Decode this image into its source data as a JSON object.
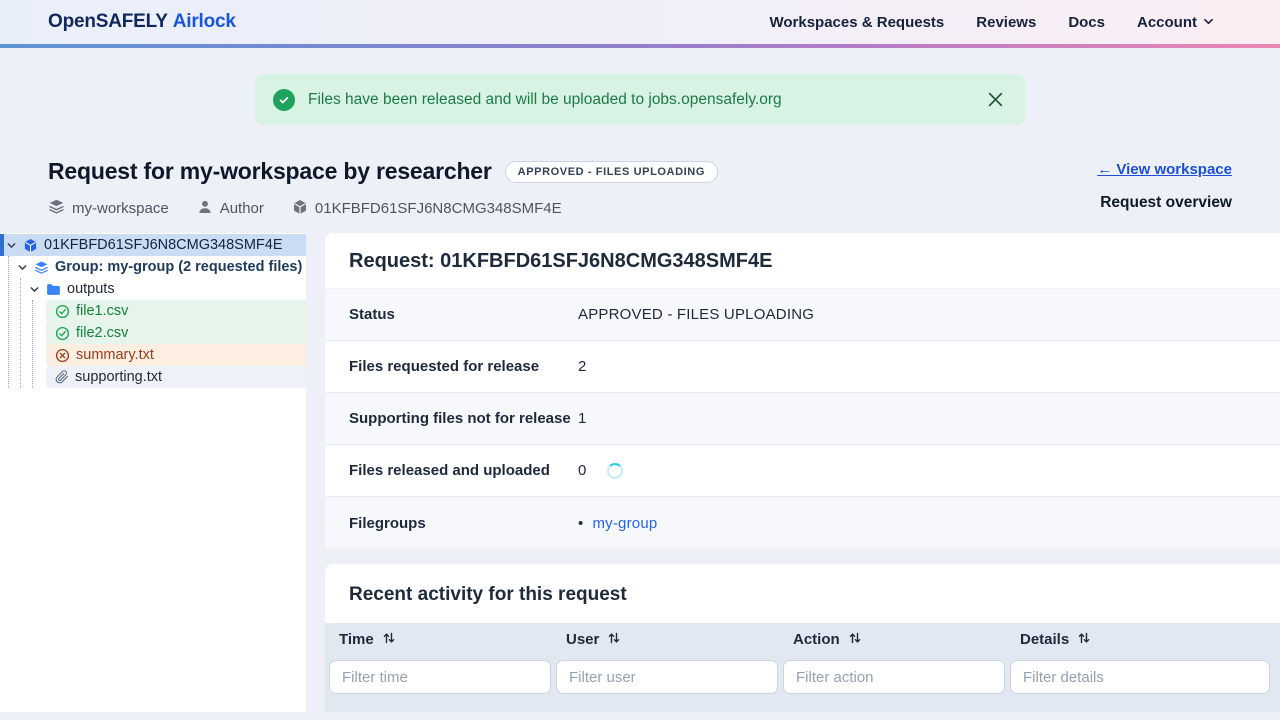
{
  "navbar": {
    "brand_primary": "OpenSAFELY",
    "brand_secondary": "Airlock",
    "links": [
      {
        "label": "Workspaces & Requests"
      },
      {
        "label": "Reviews"
      },
      {
        "label": "Docs"
      },
      {
        "label": "Account"
      }
    ]
  },
  "alert": {
    "message": "Files have been released and will be uploaded to jobs.opensafely.org"
  },
  "header": {
    "title": "Request for my-workspace by researcher",
    "status_badge": "APPROVED - FILES UPLOADING",
    "view_workspace_link": "← View workspace",
    "overview_label": "Request overview",
    "meta": {
      "workspace": "my-workspace",
      "author": "Author",
      "request_id": "01KFBFD61SFJ6N8CMG348SMF4E"
    }
  },
  "tree": {
    "items": [
      {
        "label": "01KFBFD61SFJ6N8CMG348SMF4E",
        "icon": "package-icon",
        "state": "selected"
      },
      {
        "label": "Group: my-group (2 requested files)",
        "icon": "layers-icon"
      },
      {
        "label": "outputs",
        "icon": "folder-icon"
      },
      {
        "label": "file1.csv",
        "icon": "circle-check-icon",
        "status": "approved"
      },
      {
        "label": "file2.csv",
        "icon": "circle-check-icon",
        "status": "approved"
      },
      {
        "label": "summary.txt",
        "icon": "circle-x-icon",
        "status": "rejected"
      },
      {
        "label": "supporting.txt",
        "icon": "paperclip-icon",
        "status": "supporting"
      }
    ]
  },
  "main": {
    "title": "Request: 01KFBFD61SFJ6N8CMG348SMF4E",
    "details": [
      {
        "label": "Status",
        "value": "APPROVED - FILES UPLOADING"
      },
      {
        "label": "Files requested for release",
        "value": "2"
      },
      {
        "label": "Supporting files not for release",
        "value": "1"
      },
      {
        "label": "Files released and uploaded",
        "value": "0",
        "uploading": true
      },
      {
        "label": "Filegroups",
        "value": "my-group",
        "is_link": true
      }
    ],
    "activity": {
      "title": "Recent activity for this request",
      "columns": [
        {
          "label": "Time",
          "filter_placeholder": "Filter time"
        },
        {
          "label": "User",
          "filter_placeholder": "Filter user"
        },
        {
          "label": "Action",
          "filter_placeholder": "Filter action"
        },
        {
          "label": "Details",
          "filter_placeholder": "Filter details"
        }
      ]
    }
  },
  "colors": {
    "success_bg": "#d8f3e3",
    "success_fg": "#1b7a48",
    "approved_fg": "#15803d",
    "rejected_fg": "#9c3a1f",
    "link_blue": "#1d4ed8",
    "accent_blue": "#2563eb",
    "gradient": [
      "#5e95d5",
      "#8b7fca",
      "#ec86b3"
    ]
  }
}
